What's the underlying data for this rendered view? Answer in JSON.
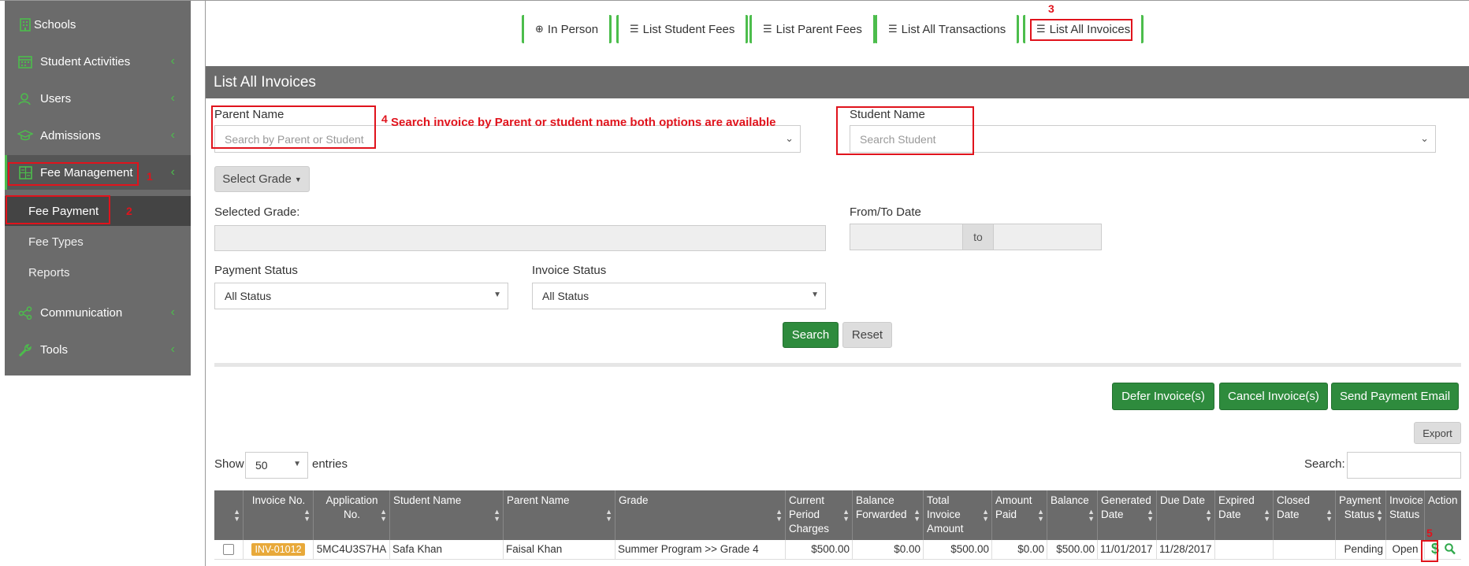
{
  "sidebar": {
    "items": [
      {
        "label": "Schools",
        "icon": "building-icon"
      },
      {
        "label": "Student Activities",
        "icon": "calendar-icon"
      },
      {
        "label": "Users",
        "icon": "users-icon"
      },
      {
        "label": "Admissions",
        "icon": "graduation-cap-icon"
      },
      {
        "label": "Fee Management",
        "icon": "calculator-icon"
      },
      {
        "label": "Communication",
        "icon": "share-icon"
      },
      {
        "label": "Tools",
        "icon": "wrench-icon"
      }
    ],
    "subitems": [
      {
        "label": "Fee Payment"
      },
      {
        "label": "Fee Types"
      },
      {
        "label": "Reports"
      }
    ]
  },
  "annotations": {
    "n1": "1",
    "n2": "2",
    "n3": "3",
    "n4": "4",
    "n5": "5",
    "search_hint": "Search invoice by Parent or student name both options are available"
  },
  "tabs": [
    {
      "label": "In Person",
      "icon": "plus-circle-icon"
    },
    {
      "label": "List Student Fees",
      "icon": "list-icon"
    },
    {
      "label": "List Parent Fees",
      "icon": "list-icon"
    },
    {
      "label": "List All Transactions",
      "icon": "list-icon"
    },
    {
      "label": "List All Invoices",
      "icon": "list-icon"
    }
  ],
  "panel": {
    "title": "List All Invoices",
    "parent_name_label": "Parent Name",
    "parent_name_placeholder": "Search by Parent or Student",
    "student_name_label": "Student Name",
    "student_name_placeholder": "Search Student",
    "select_grade": "Select Grade",
    "selected_grade_label": "Selected Grade:",
    "from_to_label": "From/To Date",
    "to_text": "to",
    "payment_status_label": "Payment Status",
    "payment_status_value": "All Status",
    "invoice_status_label": "Invoice Status",
    "invoice_status_value": "All Status",
    "search_btn": "Search",
    "reset_btn": "Reset",
    "defer_btn": "Defer Invoice(s)",
    "cancel_btn": "Cancel Invoice(s)",
    "email_btn": "Send Payment Email",
    "export_btn": "Export",
    "show_label": "Show",
    "entries_value": "50",
    "entries_label": "entries",
    "search_label": "Search:"
  },
  "table": {
    "headers": [
      "",
      "Invoice No.",
      "Application No.",
      "Student Name",
      "Parent Name",
      "Grade",
      "Current Period Charges",
      "Balance Forwarded",
      "Total Invoice Amount",
      "Amount Paid",
      "Balance",
      "Generated Date",
      "Due Date",
      "Expired Date",
      "Closed Date",
      "Payment Status",
      "Invoice Status",
      "Action"
    ],
    "rows": [
      {
        "invoice_no": "INV-01012",
        "application_no": "5MC4U3S7HA",
        "student_name": "Safa Khan",
        "parent_name": "Faisal Khan",
        "grade": "Summer Program >> Grade 4",
        "current_period_charges": "$500.00",
        "balance_forwarded": "$0.00",
        "total_invoice_amount": "$500.00",
        "amount_paid": "$0.00",
        "balance": "$500.00",
        "generated_date": "11/01/2017",
        "due_date": "11/28/2017",
        "expired_date": "",
        "closed_date": "",
        "payment_status": "Pending",
        "invoice_status": "Open"
      }
    ]
  },
  "colors": {
    "accent": "#4cbd4c",
    "primary_button": "#2e8b3d",
    "header_gray": "#6b6b6b",
    "annotation_red": "#e0131c",
    "badge": "#e8a93a"
  }
}
